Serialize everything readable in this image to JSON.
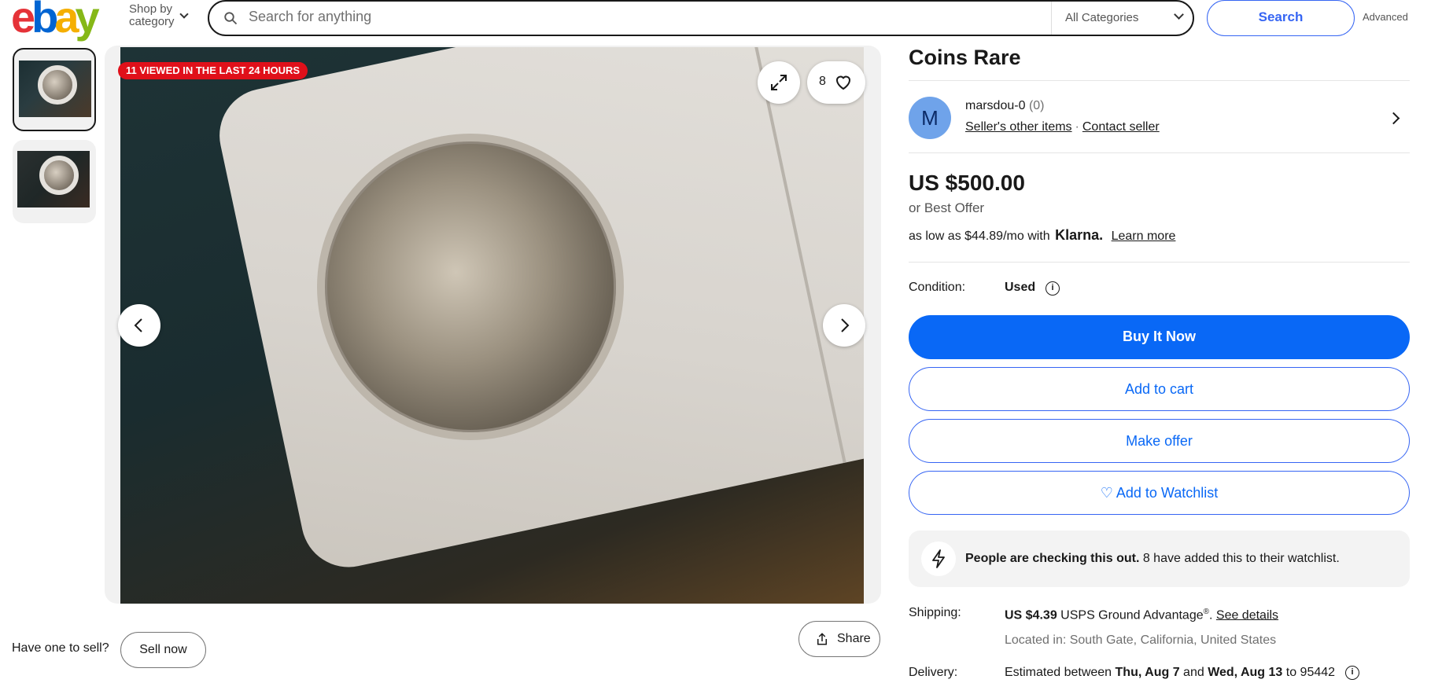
{
  "header": {
    "logo": {
      "e": "e",
      "b": "b",
      "a": "a",
      "y": "y"
    },
    "shop_by_category": "Shop by\ncategory",
    "search_placeholder": "Search for anything",
    "category_select": "All Categories",
    "search_button": "Search",
    "advanced_link": "Advanced"
  },
  "gallery": {
    "viewed_badge": "11 VIEWED IN THE LAST 24 HOURS",
    "watch_count": "8",
    "icons": {
      "expand": "expand-icon",
      "heart": "heart-icon",
      "prev": "chevron-left-icon",
      "next": "chevron-right-icon",
      "share": "share-icon"
    },
    "share_label": "Share"
  },
  "sell": {
    "prompt": "Have one to sell?",
    "button": "Sell now"
  },
  "item": {
    "title": "Coins Rare",
    "seller": {
      "avatar_letter": "M",
      "name": "marsdou-0",
      "feedback": "(0)",
      "other_items": "Seller's other items",
      "separator": "·",
      "contact": "Contact seller"
    },
    "price": "US $500.00",
    "best_offer": "or Best Offer",
    "klarna": {
      "prefix": "as low as $44.89/mo with",
      "brand": "Klarna.",
      "learn_more": "Learn more"
    },
    "condition_label": "Condition:",
    "condition_value": "Used",
    "buttons": {
      "buy_now": "Buy It Now",
      "add_to_cart": "Add to cart",
      "make_offer": "Make offer",
      "watchlist": "♡ Add to Watchlist"
    },
    "alert": {
      "bold": "People are checking this out.",
      "rest": " 8 have added this to their watchlist."
    },
    "shipping": {
      "label": "Shipping:",
      "price": "US $4.39",
      "service": " USPS Ground Advantage",
      "reg": "®",
      "period": ". ",
      "see_details": "See details",
      "location": "Located in: South Gate, California, United States"
    },
    "delivery": {
      "label": "Delivery:",
      "prefix": "Estimated between ",
      "start": "Thu, Aug 7",
      "and": " and ",
      "end": "Wed, Aug 13",
      "to": " to 95442"
    }
  },
  "colors": {
    "primary_blue": "#0968f6",
    "outline_blue": "#3665f3",
    "badge_red": "#e0101a",
    "avatar_blue": "#6fa3ea"
  }
}
